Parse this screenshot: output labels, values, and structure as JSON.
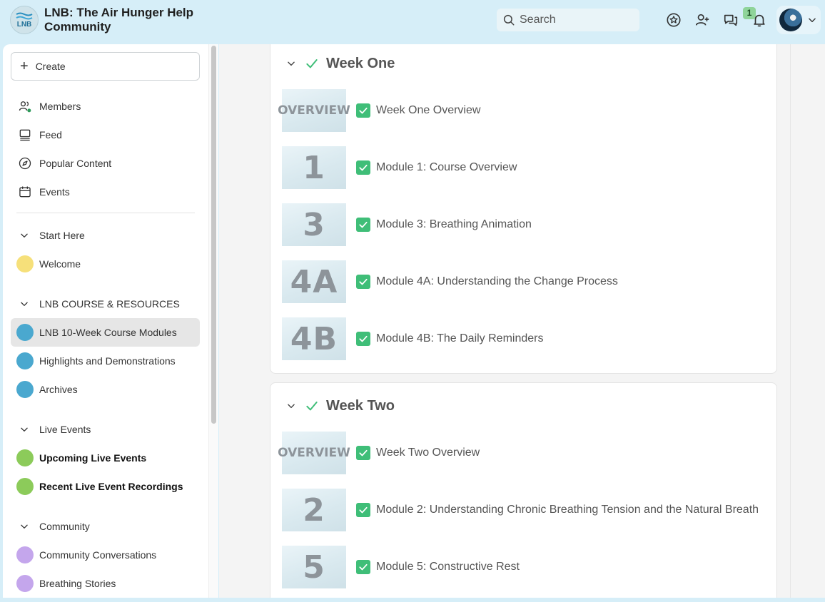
{
  "header": {
    "logo_text": "LNB",
    "title": "LNB: The Air Hunger Help Community",
    "search_placeholder": "Search",
    "messages_badge": "1",
    "icons": [
      "star-icon",
      "add-user-icon",
      "messages-icon",
      "bell-icon"
    ]
  },
  "sidebar": {
    "create_label": "Create",
    "nav": [
      {
        "label": "Members",
        "icon": "members-icon"
      },
      {
        "label": "Feed",
        "icon": "feed-icon"
      },
      {
        "label": "Popular Content",
        "icon": "compass-icon"
      },
      {
        "label": "Events",
        "icon": "calendar-icon"
      }
    ],
    "sections": [
      {
        "title": "Start Here",
        "spaces": [
          {
            "label": "Welcome",
            "color": "#f6e07a"
          }
        ]
      },
      {
        "title": "LNB COURSE & RESOURCES",
        "spaces": [
          {
            "label": "LNB 10-Week Course Modules",
            "color": "#4aa8cf",
            "active": true
          },
          {
            "label": "Highlights and Demonstrations",
            "color": "#4aa8cf"
          },
          {
            "label": "Archives",
            "color": "#4aa8cf"
          }
        ]
      },
      {
        "title": "Live Events",
        "spaces": [
          {
            "label": "Upcoming Live Events",
            "color": "#8ccb5a",
            "bold": true
          },
          {
            "label": "Recent Live Event Recordings",
            "color": "#8ccb5a",
            "bold": true
          }
        ]
      },
      {
        "title": "Community",
        "spaces": [
          {
            "label": "Community Conversations",
            "color": "#c4a6ec"
          },
          {
            "label": "Breathing Stories",
            "color": "#c4a6ec"
          }
        ]
      }
    ]
  },
  "weeks": [
    {
      "title": "Week One",
      "lessons": [
        {
          "thumb": "OVERVIEW",
          "title": "Week One Overview"
        },
        {
          "thumb": "1",
          "title": "Module 1: Course Overview"
        },
        {
          "thumb": "3",
          "title": "Module 3: Breathing Animation"
        },
        {
          "thumb": "4A",
          "title": "Module 4A: Understanding the Change Process"
        },
        {
          "thumb": "4B",
          "title": "Module 4B: The Daily Reminders"
        }
      ]
    },
    {
      "title": "Week Two",
      "lessons": [
        {
          "thumb": "OVERVIEW",
          "title": "Week Two Overview"
        },
        {
          "thumb": "2",
          "title": "Module 2: Understanding Chronic Breathing Tension and the Natural Breath"
        },
        {
          "thumb": "5",
          "title": "Module 5: Constructive Rest"
        }
      ]
    }
  ],
  "colors": {
    "accent_green": "#3fbe78",
    "header_bg": "#d6eef8"
  }
}
